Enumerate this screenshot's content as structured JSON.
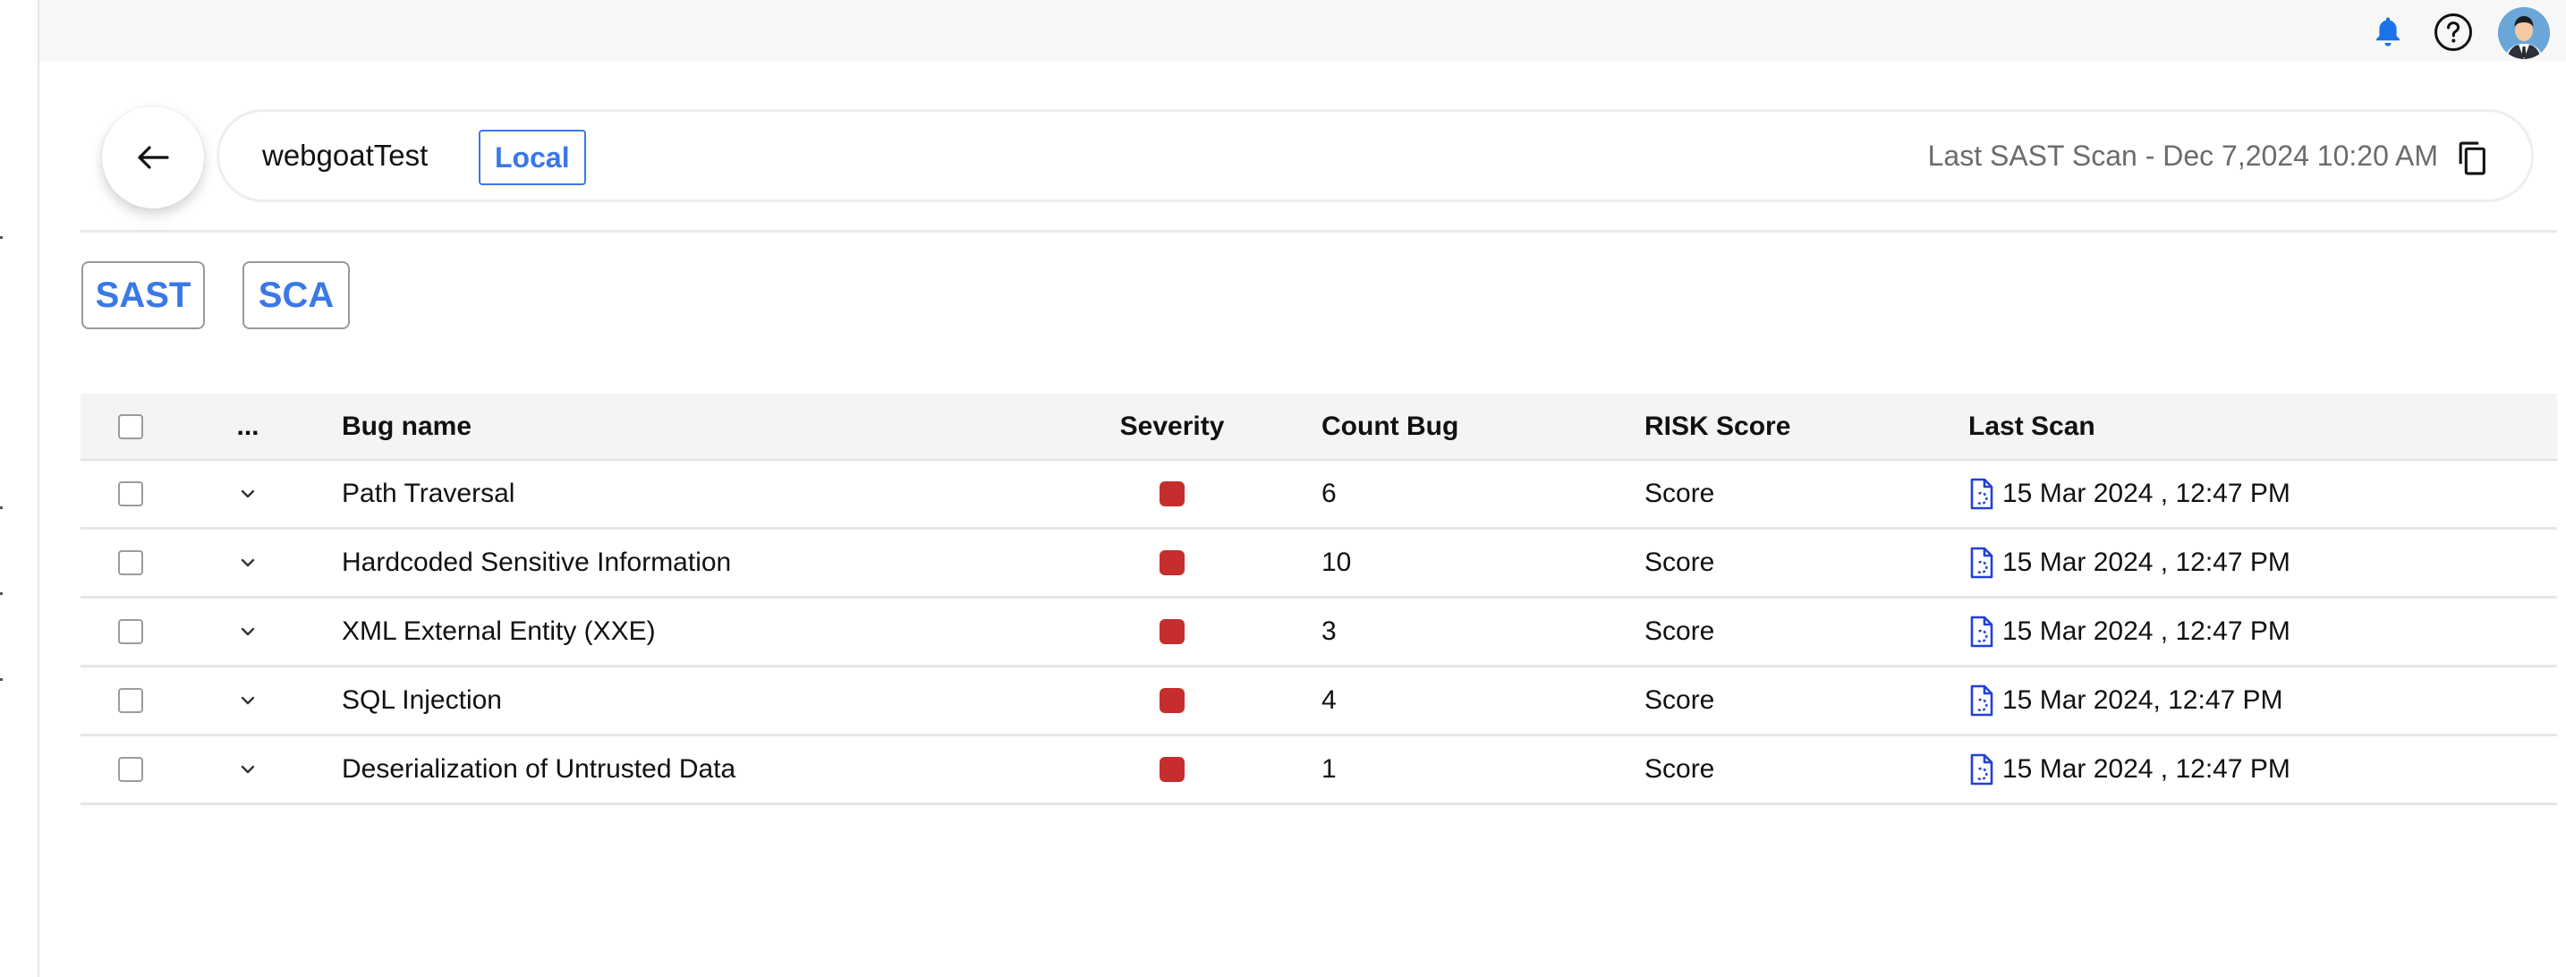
{
  "header": {
    "project_name": "webgoatTest",
    "badge": "Local",
    "last_scan": "Last SAST Scan - Dec 7,2024 10:20 AM"
  },
  "tabs": [
    {
      "label": "SAST"
    },
    {
      "label": "SCA"
    }
  ],
  "table": {
    "columns": {
      "more": "...",
      "bug_name": "Bug name",
      "severity": "Severity",
      "count_bug": "Count Bug",
      "risk_score": "RISK Score",
      "last_scan": "Last Scan"
    },
    "rows": [
      {
        "bug_name": "Path Traversal",
        "count": "6",
        "risk": "Score",
        "last_scan": "15 Mar 2024 , 12:47 PM"
      },
      {
        "bug_name": "Hardcoded Sensitive Information",
        "count": "10",
        "risk": "Score",
        "last_scan": "15 Mar 2024 , 12:47 PM"
      },
      {
        "bug_name": "XML External Entity (XXE)",
        "count": "3",
        "risk": "Score",
        "last_scan": "15 Mar 2024 , 12:47 PM"
      },
      {
        "bug_name": "SQL Injection",
        "count": "4",
        "risk": "Score",
        "last_scan": "15 Mar 2024, 12:47 PM"
      },
      {
        "bug_name": "Deserialization of Untrusted Data",
        "count": "1",
        "risk": "Score",
        "last_scan": "15 Mar 2024 , 12:47 PM"
      }
    ]
  },
  "colors": {
    "accent": "#3b78e7",
    "severity_high": "#c62d2d",
    "bell": "#1a73e8"
  },
  "icons": [
    "bell-icon",
    "help-icon",
    "avatar",
    "back-arrow-icon",
    "copy-icon",
    "chevron-down-icon",
    "file-icon"
  ]
}
